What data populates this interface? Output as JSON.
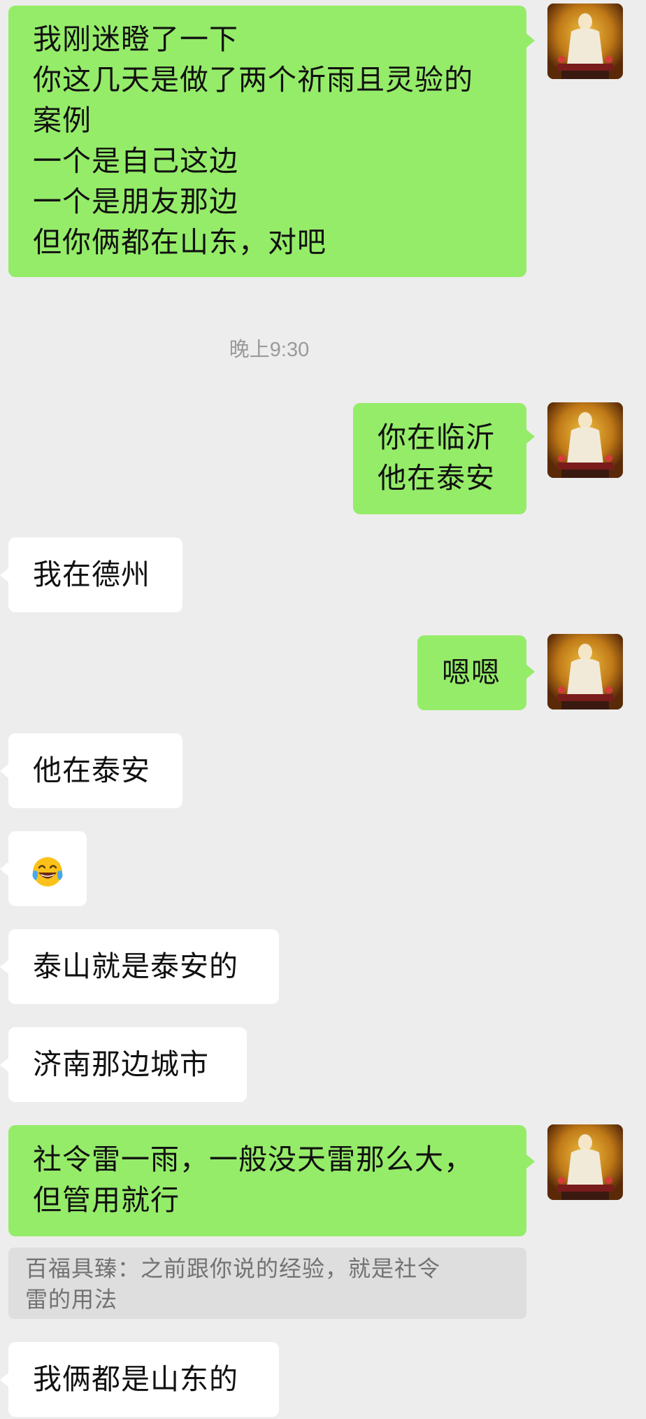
{
  "chat": {
    "messages": [
      {
        "side": "right",
        "text": "我刚迷瞪了一下\n你这几天是做了两个祈雨且灵验的\n案例\n一个是自己这边\n一个是朋友那边\n但你俩都在山东，对吧"
      },
      {
        "side": "right",
        "text": "你在临沂\n他在泰安"
      },
      {
        "side": "left",
        "text": "我在德州"
      },
      {
        "side": "right",
        "text": "嗯嗯"
      },
      {
        "side": "left",
        "text": "他在泰安"
      },
      {
        "side": "left",
        "emoji": "tears-of-joy-emoji"
      },
      {
        "side": "left",
        "text": "泰山就是泰安的"
      },
      {
        "side": "left",
        "text": "济南那边城市"
      },
      {
        "side": "right",
        "text": "社令雷一雨，一般没天雷那么大，\n但管用就行"
      },
      {
        "side": "left",
        "text": "我俩都是山东的"
      }
    ],
    "timestamp": "晚上9:30",
    "quote": "百福具臻：之前跟你说的经验，就是社令\n雷的用法"
  },
  "colors": {
    "background": "#ededed",
    "sent_bubble": "#95ec69",
    "received_bubble": "#ffffff",
    "quote_bg": "#dedede"
  },
  "icons": {
    "avatar": "deity-statue-avatar",
    "emoji": "tears-of-joy-emoji"
  }
}
